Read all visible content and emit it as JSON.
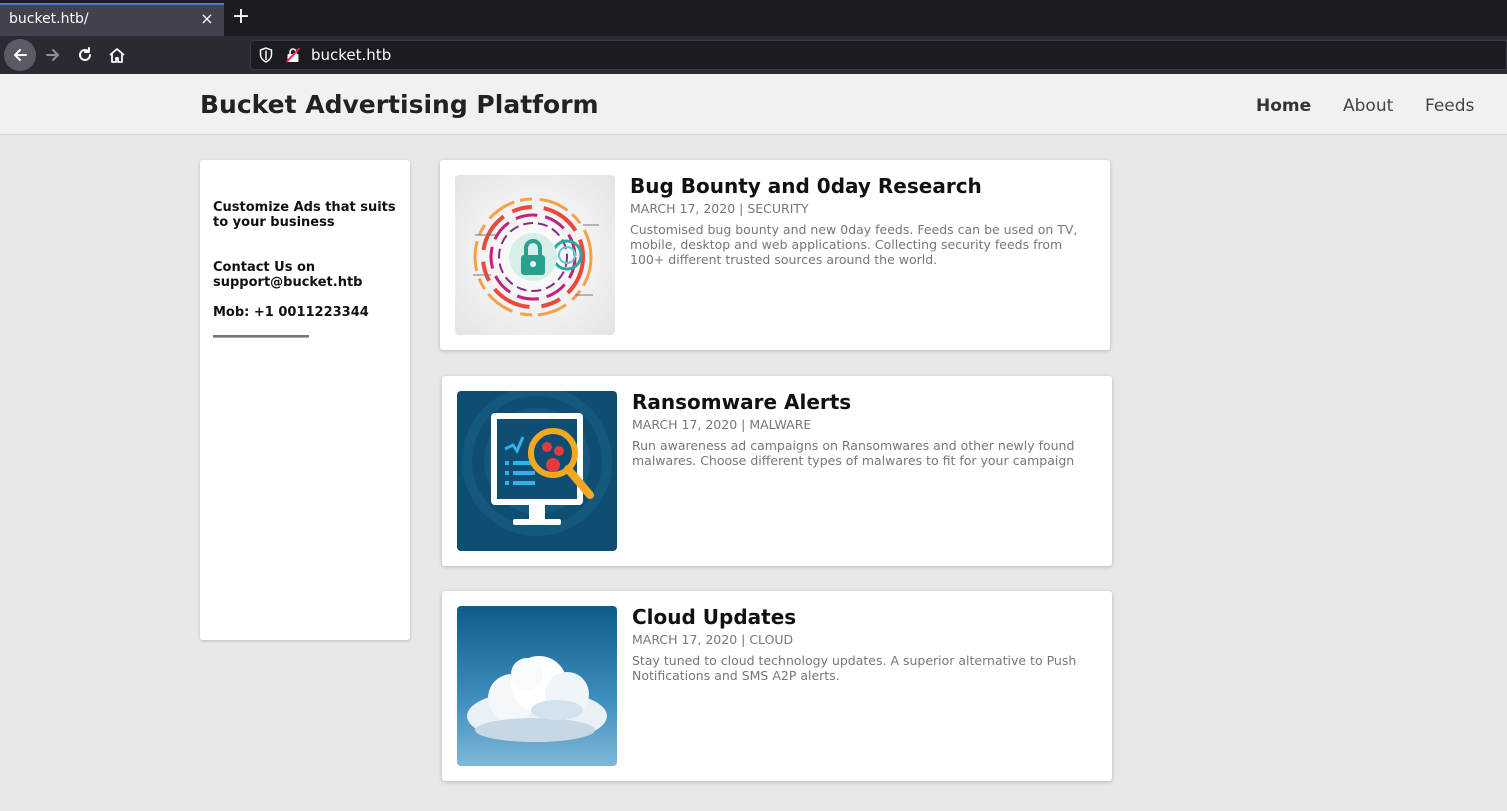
{
  "browser": {
    "tab_title": "bucket.htb/",
    "tab_close": "×",
    "new_tab": "+",
    "url": "bucket.htb"
  },
  "site": {
    "title": "Bucket Advertising Platform",
    "nav": {
      "home": "Home",
      "about": "About",
      "feeds": "Feeds"
    }
  },
  "sidebar": {
    "tagline": "Customize Ads that suits to your business",
    "contact": "Contact Us on support@bucket.htb",
    "mobile": "Mob: +1 0011223344"
  },
  "posts": [
    {
      "title": "Bug Bounty and 0day Research",
      "meta": "MARCH 17, 2020 | SECURITY",
      "description": "Customised bug bounty and new 0day feeds. Feeds can be used on TV, mobile, desktop and web applications. Collecting security feeds from 100+ different trusted sources around the world.",
      "image": "security-lock-image"
    },
    {
      "title": "Ransomware Alerts",
      "meta": "MARCH 17, 2020 | MALWARE",
      "description": "Run awareness ad campaigns on Ransomwares and other newly found malwares. Choose different types of malwares to fit for your campaign",
      "image": "malware-magnifier-image"
    },
    {
      "title": "Cloud Updates",
      "meta": "MARCH 17, 2020 | CLOUD",
      "description": "Stay tuned to cloud technology updates. A superior alternative to Push Notifications and SMS A2P alerts.",
      "image": "cloud-sky-image"
    }
  ],
  "colors": {
    "tab_accent": "#4a79d8",
    "page_bg": "#e8e8e8",
    "header_bg": "#f1f1f1"
  }
}
